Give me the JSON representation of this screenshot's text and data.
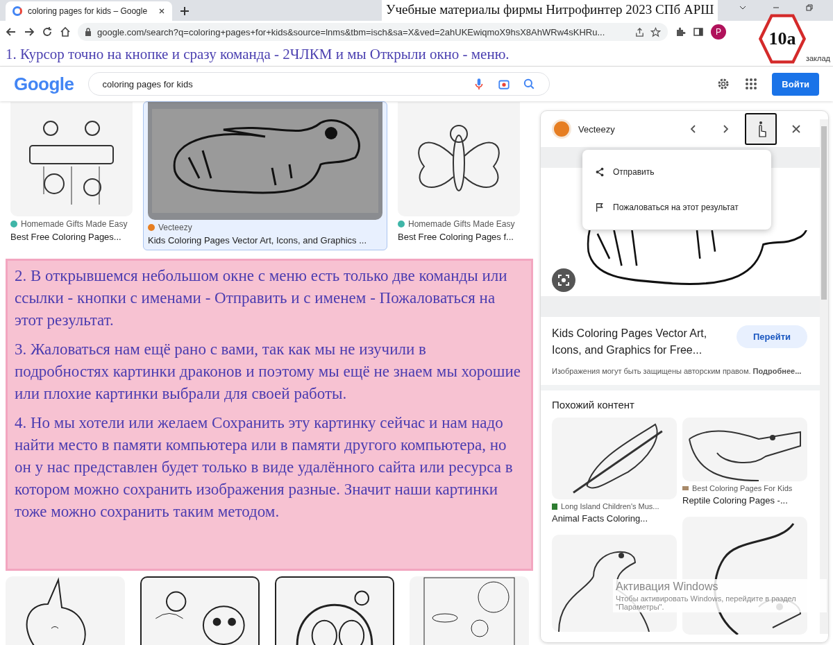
{
  "browser": {
    "tab_title": "coloring pages for kids – Google",
    "address": "google.com/search?q=coloring+pages+for+kids&source=lnms&tbm=isch&sa=X&ved=2ahUKEwiqmoX9hsX8AhWRw4sKHRu...",
    "profile_initial": "P",
    "bookmarks_text": "заклад"
  },
  "overlay_title": "Учебные материалы фирмы Нитрофинтер 2023 СПб АРШ",
  "badge": "10a",
  "annotation_top": "1. Курсор точно на кнопке и сразу команда - 2ЧЛКМ и мы Открыли окно - меню.",
  "google": {
    "logo": "Google",
    "query": "coloring pages for kids",
    "sign_in": "Войти"
  },
  "results": [
    {
      "source": "Homemade Gifts Made Easy",
      "title": "Best Free Coloring Pages...",
      "color": "#3fb6a8",
      "selected": false,
      "kind": "winter"
    },
    {
      "source": "Vecteezy",
      "title": "Kids Coloring Pages Vector Art, Icons, and Graphics ...",
      "color": "#e67e22",
      "selected": true,
      "kind": "lizard"
    },
    {
      "source": "Homemade Gifts Made Easy",
      "title": "Best Free Coloring Pages f...",
      "color": "#3fb6a8",
      "selected": false,
      "kind": "butterfly"
    }
  ],
  "annotations": [
    "2. В открывшемся небольшом окне с меню есть только две команды или ссылки - кнопки с именами - Отправить и с именем - Пожаловаться на этот результат.",
    "3. Жаловаться нам ещё рано с вами, так как мы не изучили в подробностях картинки драконов и поэтому мы ещё не знаем мы хорошие или плохие картинки выбрали для своей работы.",
    "4. Но мы хотели или желаем Сохранить эту картинку сейчас и нам надо найти место в памяти компьютера или в памяти другого компьютера, но он у нас представлен будет только в виде удалённого сайта или ресурса в котором можно сохранить изображения разные. Значит наши картинки тоже  можно сохранить таким методом."
  ],
  "panel": {
    "source": "Vecteezy",
    "menu": [
      {
        "kind": "share",
        "label": "Отправить"
      },
      {
        "kind": "report",
        "label": "Пожаловаться на этот результат"
      }
    ],
    "title": "Kids Coloring Pages Vector Art, Icons, and Graphics for Free...",
    "visit": "Перейти",
    "notice": "Изображения могут быть защищены авторским правом. **Подробнее...**",
    "similar_heading": "Похожий контент",
    "similar": [
      {
        "source": "Long Island Children's Mus...",
        "title": "Animal Facts Coloring..."
      },
      {
        "source": "Best Coloring Pages For Kids",
        "title": "Reptile Coloring Pages -..."
      }
    ]
  },
  "os_watermark": {
    "title": "Активация Windows",
    "text": "Чтобы активировать Windows, перейдите в раздел \"Параметры\"."
  }
}
